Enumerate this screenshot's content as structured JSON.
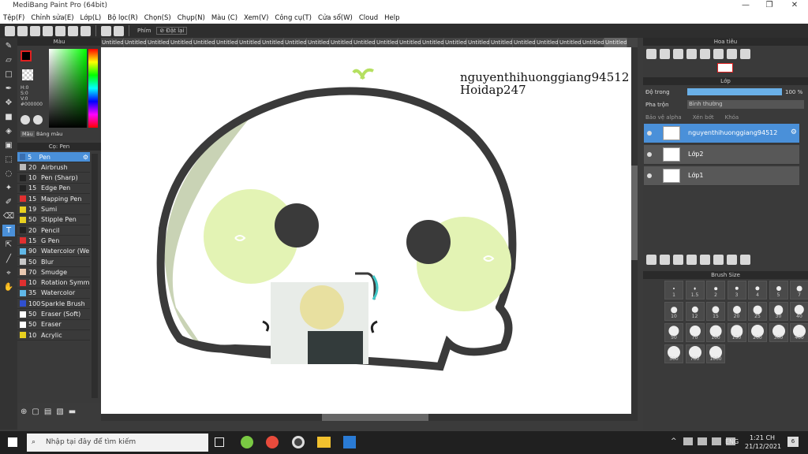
{
  "window": {
    "title": "MediBang Paint Pro (64bit)",
    "controls": [
      "—",
      "❐",
      "✕"
    ]
  },
  "menu": [
    "Tệp(F)",
    "Chỉnh sửa(E)",
    "Lớp(L)",
    "Bộ lọc(R)",
    "Chọn(S)",
    "Chụp(N)",
    "Màu (C)",
    "Xem(V)",
    "Công cụ(T)",
    "Cửa sổ(W)",
    "Cloud",
    "Help"
  ],
  "toolbar": {
    "shortcut_label": "Phím",
    "reset_label": "Đặt lại"
  },
  "tabs": [
    "Untitled",
    "Untitled",
    "Untitled",
    "Untitled",
    "Untitled",
    "Untitled",
    "Untitled",
    "Untitled",
    "Untitled",
    "Untitled",
    "Untitled",
    "Untitled",
    "Untitled",
    "Untitled",
    "Untitled",
    "Untitled",
    "Untitled",
    "Untitled",
    "Untitled",
    "Untitled",
    "Untitled",
    "Untitled",
    "Untitled"
  ],
  "color_panel": {
    "title": "Màu",
    "h": "H:0",
    "s": "S:0",
    "v": "V:0",
    "hex": "#000000",
    "tab_color": "Màu",
    "tab_palette": "Bảng màu"
  },
  "brush_panel": {
    "title": "Cọ: Pen",
    "brushes": [
      {
        "size": "5",
        "name": "Pen",
        "color": "#3a6fb0"
      },
      {
        "size": "20",
        "name": "Airbrush",
        "color": "#bbbbbb"
      },
      {
        "size": "10",
        "name": "Pen (Sharp)",
        "color": "#222222"
      },
      {
        "size": "15",
        "name": "Edge Pen",
        "color": "#222222"
      },
      {
        "size": "15",
        "name": "Mapping Pen",
        "color": "#e03030"
      },
      {
        "size": "19",
        "name": "Sumi",
        "color": "#e8d020"
      },
      {
        "size": "50",
        "name": "Stipple Pen",
        "color": "#e8d020"
      },
      {
        "size": "20",
        "name": "Pencil",
        "color": "#222222"
      },
      {
        "size": "15",
        "name": "G Pen",
        "color": "#e03030"
      },
      {
        "size": "90",
        "name": "Watercolor (We",
        "color": "#60b8e8"
      },
      {
        "size": "50",
        "name": "Blur",
        "color": "#c8c8c8"
      },
      {
        "size": "70",
        "name": "Smudge",
        "color": "#e8c8b0"
      },
      {
        "size": "10",
        "name": "Rotation Symm",
        "color": "#e03030"
      },
      {
        "size": "35",
        "name": "Watercolor",
        "color": "#60b8e8"
      },
      {
        "size": "100",
        "name": "Sparkle Brush",
        "color": "#3050d0"
      },
      {
        "size": "50",
        "name": "Eraser (Soft)",
        "color": "#ffffff"
      },
      {
        "size": "50",
        "name": "Eraser",
        "color": "#ffffff"
      },
      {
        "size": "10",
        "name": "Acrylic",
        "color": "#e8d020"
      }
    ]
  },
  "canvas": {
    "text_line1": "nguyenthihuonggiang94512",
    "text_line2": "Hoidap247"
  },
  "navigator": {
    "title": "Hoa tiêu"
  },
  "layer_panel": {
    "title": "Lớp",
    "opacity_label": "Độ trong",
    "opacity_value": "100 %",
    "blend_label": "Pha trộn",
    "blend_value": "Bình thường",
    "protect_alpha": "Bảo vệ alpha",
    "clip": "Xén bớt",
    "lock": "Khóa",
    "layers": [
      "nguyenthihuonggiang94512",
      "Lớp2",
      "Lớp1"
    ]
  },
  "brush_size": {
    "title": "Brush Size",
    "sizes": [
      "1",
      "1.5",
      "2",
      "3",
      "4",
      "5",
      "7",
      "10",
      "12",
      "15",
      "20",
      "25",
      "30",
      "40",
      "50",
      "70",
      "100",
      "150",
      "200",
      "300",
      "400",
      "500",
      "700",
      "1000"
    ]
  },
  "taskbar": {
    "search_placeholder": "Nhập tại đây để tìm kiếm",
    "language": "ENG",
    "time": "1:21 CH",
    "date": "21/12/2021",
    "notif_count": "6"
  }
}
